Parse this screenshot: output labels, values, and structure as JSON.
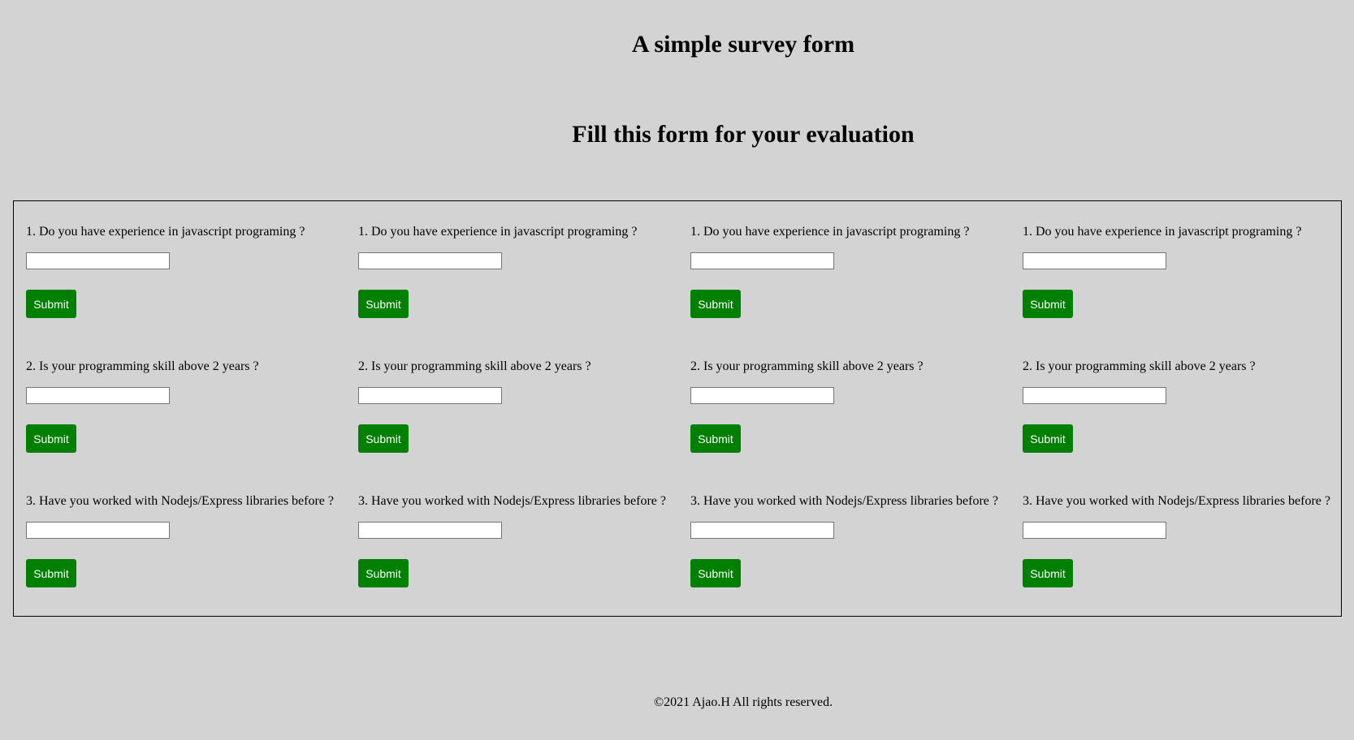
{
  "header": {
    "title": "A simple survey form",
    "subtitle": "Fill this form for your evaluation"
  },
  "survey": {
    "columns": [
      {
        "questions": [
          {
            "label": "1. Do you have experience in javascript programing ?",
            "value": "",
            "submit_label": "Submit"
          },
          {
            "label": "2. Is your programming skill above 2 years ?",
            "value": "",
            "submit_label": "Submit"
          },
          {
            "label": "3. Have you worked with Nodejs/Express libraries before ?",
            "value": "",
            "submit_label": "Submit"
          }
        ]
      },
      {
        "questions": [
          {
            "label": "1. Do you have experience in javascript programing ?",
            "value": "",
            "submit_label": "Submit"
          },
          {
            "label": "2. Is your programming skill above 2 years ?",
            "value": "",
            "submit_label": "Submit"
          },
          {
            "label": "3. Have you worked with Nodejs/Express libraries before ?",
            "value": "",
            "submit_label": "Submit"
          }
        ]
      },
      {
        "questions": [
          {
            "label": "1. Do you have experience in javascript programing ?",
            "value": "",
            "submit_label": "Submit"
          },
          {
            "label": "2. Is your programming skill above 2 years ?",
            "value": "",
            "submit_label": "Submit"
          },
          {
            "label": "3. Have you worked with Nodejs/Express libraries before ?",
            "value": "",
            "submit_label": "Submit"
          }
        ]
      },
      {
        "questions": [
          {
            "label": "1. Do you have experience in javascript programing ?",
            "value": "",
            "submit_label": "Submit"
          },
          {
            "label": "2. Is your programming skill above 2 years ?",
            "value": "",
            "submit_label": "Submit"
          },
          {
            "label": "3. Have you worked with Nodejs/Express libraries before ?",
            "value": "",
            "submit_label": "Submit"
          }
        ]
      }
    ]
  },
  "colors": {
    "background": "#d3d3d3",
    "button": "#008000",
    "button_text": "#ffffff"
  },
  "footer": {
    "text": "©2021 Ajao.H All rights reserved."
  }
}
